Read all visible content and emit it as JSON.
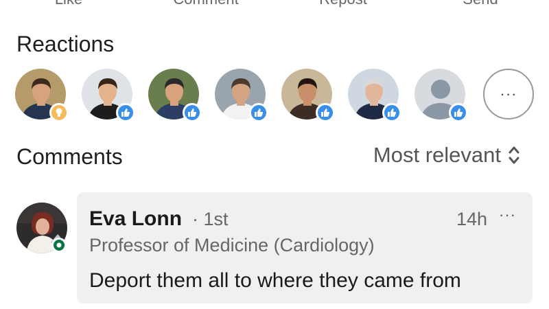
{
  "actions": [
    "Like",
    "Comment",
    "Repost",
    "Send"
  ],
  "reactions": {
    "title": "Reactions",
    "people": [
      {
        "badge": "insightful-icon",
        "bg": "#b59a6a",
        "skin": "#d9a27f",
        "hair": "#3b2a1e",
        "shirt": "#25344f"
      },
      {
        "badge": "like-icon",
        "bg": "#dfe3e8",
        "skin": "#e4b38e",
        "hair": "#3a2618",
        "shirt": "#1d1d1d"
      },
      {
        "badge": "like-icon",
        "bg": "#6a7d4d",
        "skin": "#d8a27c",
        "hair": "#2a2a2a",
        "shirt": "#2c3e63"
      },
      {
        "badge": "like-icon",
        "bg": "#9aa4ad",
        "skin": "#d4a382",
        "hair": "#4a3a2e",
        "shirt": "#f2f2f2"
      },
      {
        "badge": "like-icon",
        "bg": "#c9b79a",
        "skin": "#c98e6a",
        "hair": "#231611",
        "shirt": "#3c2c26"
      },
      {
        "badge": "like-icon",
        "bg": "#cfd8e1",
        "skin": "#e2b69a",
        "hair": "#d8d8d8",
        "shirt": "#1e2a44"
      },
      {
        "badge": "like-icon",
        "bg": "#d7dbe0",
        "skin": "#8a97a5",
        "hair": "#8a97a5",
        "shirt": "#8a97a5"
      }
    ],
    "more_label": "···"
  },
  "comments": {
    "title": "Comments",
    "sort_label": "Most relevant",
    "items": [
      {
        "author": "Eva Lonn",
        "degree": "· 1st",
        "headline": "Professor of Medicine (Cardiology)",
        "time": "14h",
        "more": "···",
        "text": "Deport them all to where they came from"
      }
    ]
  },
  "colors": {
    "like": "#378fe9",
    "insightful": "#f5bb5c",
    "online": "#057642"
  }
}
